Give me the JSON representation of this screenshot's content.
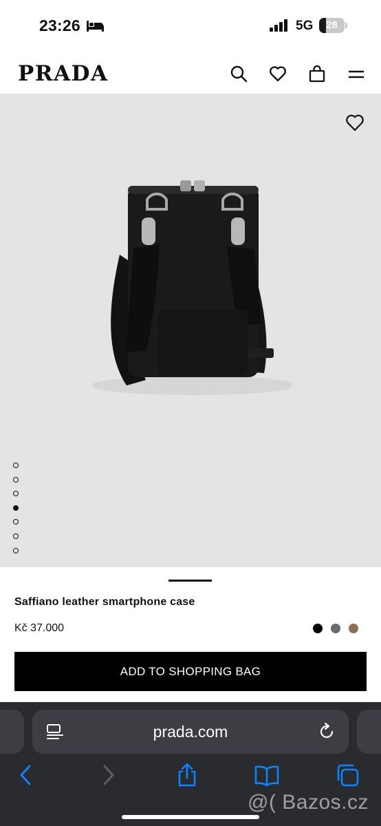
{
  "status_bar": {
    "time": "23:26",
    "focus_icon": "bed-icon",
    "network": "5G",
    "battery_level": "28",
    "battery_fraction": 0.28
  },
  "header": {
    "logo": "PRADA",
    "icons": [
      "search-icon",
      "heart-icon",
      "shopping-bag-icon",
      "menu-icon"
    ]
  },
  "gallery": {
    "wishlist_icon": "heart-icon",
    "image_count": 7,
    "active_index": 3,
    "background": "#e4e4e4"
  },
  "product": {
    "name": "Saffiano leather smartphone case",
    "price": "Kč 37.000",
    "swatches": [
      {
        "color": "#000000"
      },
      {
        "color": "#6b6b6b"
      },
      {
        "color": "#8c7050"
      }
    ],
    "add_to_bag_label": "ADD TO SHOPPING BAG"
  },
  "browser": {
    "url": "prada.com",
    "toolbar_icons": [
      "back-arrow-icon",
      "forward-arrow-icon",
      "share-icon",
      "bookmarks-icon",
      "tabs-icon"
    ],
    "accent": "#0a84ff"
  },
  "watermark": "@( Bazos.cz"
}
